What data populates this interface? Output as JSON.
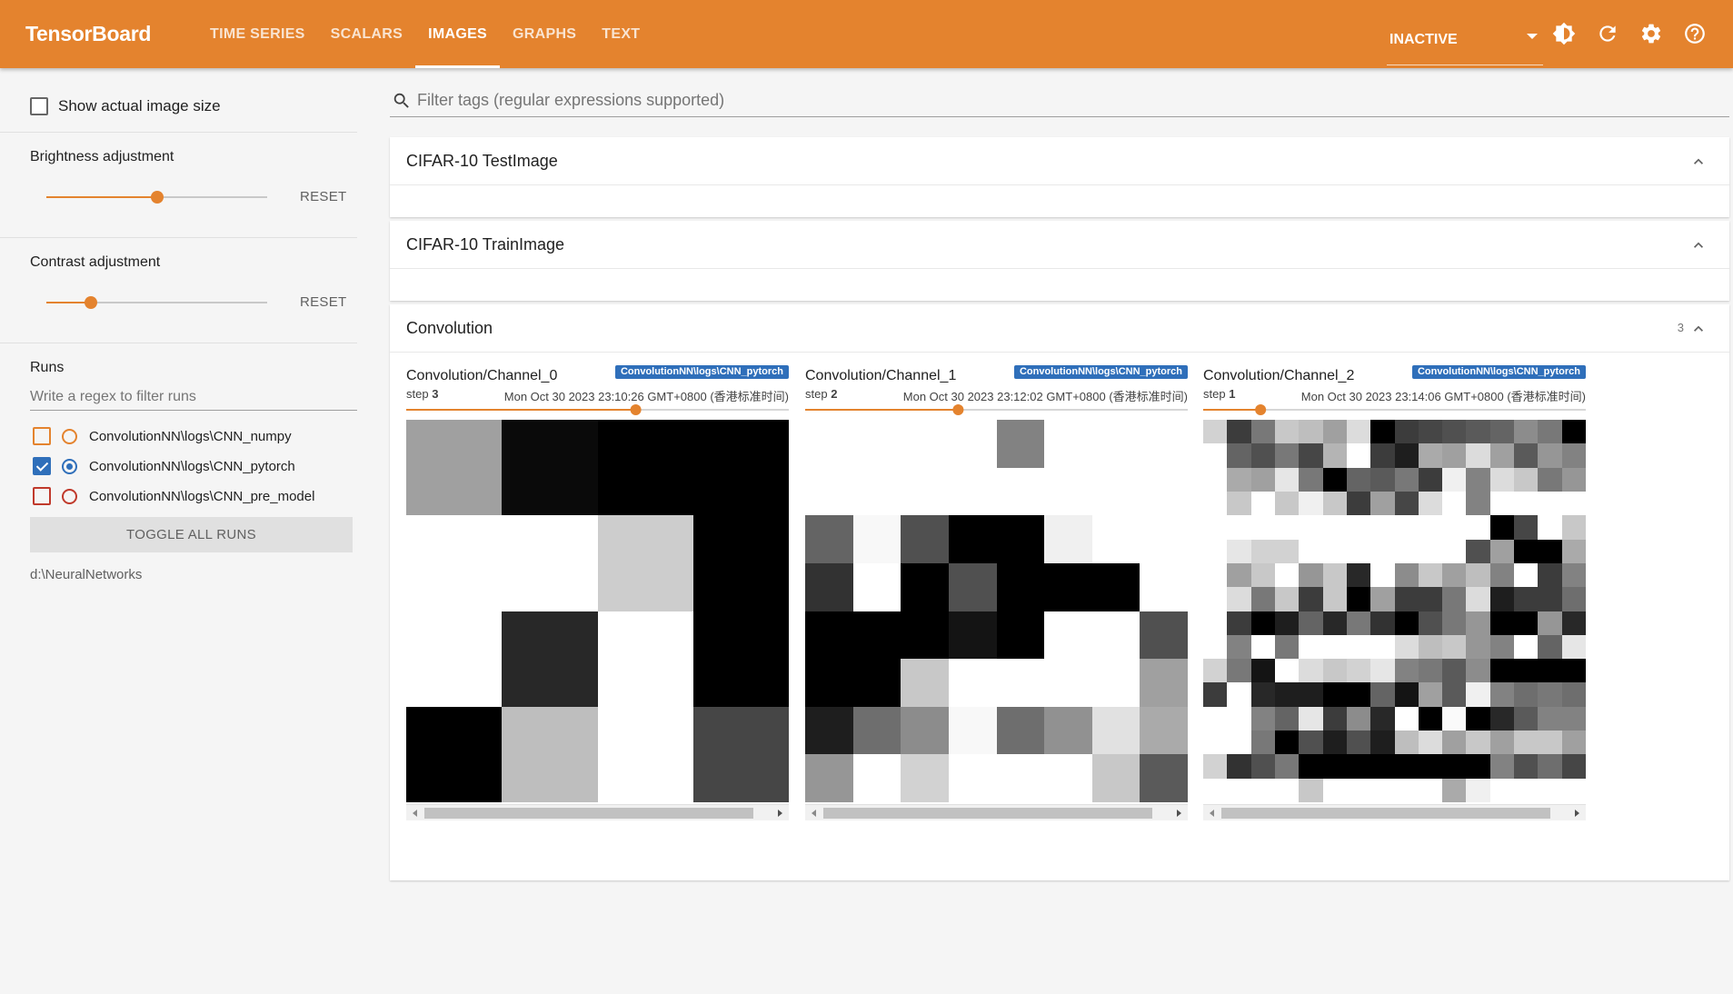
{
  "app": {
    "brand": "TensorBoard"
  },
  "nav": {
    "tabs": [
      {
        "label": "TIME SERIES"
      },
      {
        "label": "SCALARS"
      },
      {
        "label": "IMAGES",
        "active": true
      },
      {
        "label": "GRAPHS"
      },
      {
        "label": "TEXT"
      }
    ],
    "status_select": "INACTIVE",
    "icons": [
      "brightness-icon",
      "refresh-icon",
      "settings-icon",
      "help-icon"
    ]
  },
  "sidebar": {
    "show_actual_size_label": "Show actual image size",
    "show_actual_size_checked": false,
    "brightness": {
      "label": "Brightness adjustment",
      "reset": "RESET",
      "level": 0.5
    },
    "contrast": {
      "label": "Contrast adjustment",
      "reset": "RESET",
      "level": 0.2
    },
    "runs": {
      "title": "Runs",
      "filter_placeholder": "Write a regex to filter runs",
      "items": [
        {
          "name": "ConvolutionNN\\logs\\CNN_numpy",
          "checked": false,
          "selected": false,
          "color": "#e4832e"
        },
        {
          "name": "ConvolutionNN\\logs\\CNN_pytorch",
          "checked": true,
          "selected": true,
          "color": "#2f6fba"
        },
        {
          "name": "ConvolutionNN\\logs\\CNN_pre_model",
          "checked": false,
          "selected": false,
          "color": "#c0392b"
        }
      ],
      "toggle_all": "TOGGLE ALL RUNS",
      "logdir": "d:\\NeuralNetworks"
    }
  },
  "main": {
    "filter_placeholder": "Filter tags (regular expressions supported)",
    "groups": [
      {
        "title": "CIFAR-10 TestImage",
        "expanded": true
      },
      {
        "title": "CIFAR-10 TrainImage",
        "expanded": true
      },
      {
        "title": "Convolution",
        "count": "3",
        "expanded": true
      }
    ],
    "images": [
      {
        "tag": "Convolution/Channel_0",
        "run": "ConvolutionNN\\logs\\CNN_pytorch",
        "step_label": "step",
        "step": "3",
        "timestamp": "Mon Oct 30 2023 23:10:26 GMT+0800 (香港标准时间)",
        "step_position": 0.6,
        "grid_size": 4,
        "pixels": [
          [
            160,
            10,
            0,
            0
          ],
          [
            255,
            255,
            205,
            0
          ],
          [
            255,
            40,
            255,
            0
          ],
          [
            0,
            190,
            255,
            70
          ]
        ]
      },
      {
        "tag": "Convolution/Channel_1",
        "run": "ConvolutionNN\\logs\\CNN_pytorch",
        "step_label": "step",
        "step": "2",
        "timestamp": "Mon Oct 30 2023 23:12:02 GMT+0800 (香港标准时间)",
        "step_position": 0.4,
        "grid_size": 8,
        "pixels": [
          [
            255,
            255,
            255,
            255,
            130,
            255,
            255,
            255
          ],
          [
            255,
            255,
            255,
            255,
            255,
            255,
            255,
            255
          ],
          [
            100,
            248,
            80,
            0,
            0,
            240,
            255,
            255
          ],
          [
            50,
            255,
            0,
            80,
            0,
            0,
            0,
            255
          ],
          [
            0,
            0,
            0,
            20,
            0,
            255,
            255,
            80
          ],
          [
            0,
            0,
            200,
            255,
            255,
            255,
            255,
            160
          ],
          [
            30,
            110,
            140,
            248,
            110,
            145,
            225,
            170
          ],
          [
            150,
            255,
            210,
            255,
            255,
            255,
            200,
            90
          ]
        ]
      },
      {
        "tag": "Convolution/Channel_2",
        "run": "ConvolutionNN\\logs\\CNN_pytorch",
        "step_label": "step",
        "step": "1",
        "timestamp": "Mon Oct 30 2023 23:14:06 GMT+0800 (香港标准时间)",
        "step_position": 0.15,
        "grid_size": 16,
        "pixels": [
          [
            210,
            60,
            120,
            200,
            190,
            160,
            220,
            0,
            60,
            70,
            80,
            90,
            100,
            140,
            120,
            0
          ],
          [
            255,
            100,
            80,
            120,
            70,
            180,
            255,
            60,
            30,
            170,
            160,
            220,
            160,
            90,
            150,
            130
          ],
          [
            255,
            170,
            160,
            230,
            120,
            0,
            100,
            90,
            120,
            60,
            240,
            130,
            220,
            200,
            120,
            150
          ],
          [
            255,
            200,
            255,
            200,
            240,
            200,
            60,
            160,
            70,
            220,
            255,
            130,
            255,
            255,
            255,
            255
          ],
          [
            255,
            255,
            255,
            255,
            255,
            255,
            255,
            255,
            255,
            255,
            255,
            255,
            0,
            70,
            255,
            200
          ],
          [
            255,
            230,
            210,
            210,
            255,
            255,
            255,
            255,
            255,
            255,
            255,
            80,
            160,
            0,
            0,
            170
          ],
          [
            255,
            160,
            200,
            255,
            150,
            200,
            40,
            255,
            140,
            200,
            160,
            190,
            130,
            255,
            60,
            130
          ],
          [
            255,
            220,
            120,
            200,
            60,
            200,
            0,
            160,
            60,
            60,
            120,
            220,
            30,
            60,
            60,
            110
          ],
          [
            255,
            60,
            0,
            30,
            100,
            40,
            120,
            50,
            0,
            80,
            120,
            150,
            0,
            0,
            150,
            40
          ],
          [
            255,
            130,
            255,
            120,
            255,
            255,
            255,
            255,
            220,
            190,
            200,
            150,
            130,
            255,
            100,
            230
          ],
          [
            210,
            120,
            20,
            255,
            220,
            200,
            210,
            230,
            130,
            120,
            90,
            140,
            0,
            0,
            0,
            0
          ],
          [
            60,
            255,
            40,
            30,
            30,
            0,
            0,
            100,
            20,
            160,
            90,
            240,
            130,
            110,
            120,
            110
          ],
          [
            255,
            255,
            130,
            100,
            230,
            60,
            140,
            40,
            255,
            0,
            250,
            0,
            40,
            90,
            130,
            130
          ],
          [
            255,
            255,
            120,
            0,
            80,
            30,
            80,
            30,
            190,
            220,
            160,
            200,
            160,
            200,
            200,
            160
          ],
          [
            210,
            50,
            80,
            120,
            0,
            0,
            0,
            0,
            0,
            0,
            0,
            0,
            130,
            80,
            110,
            70
          ],
          [
            255,
            255,
            255,
            255,
            200,
            255,
            255,
            255,
            255,
            255,
            170,
            240,
            255,
            255,
            255,
            255
          ]
        ]
      }
    ]
  }
}
